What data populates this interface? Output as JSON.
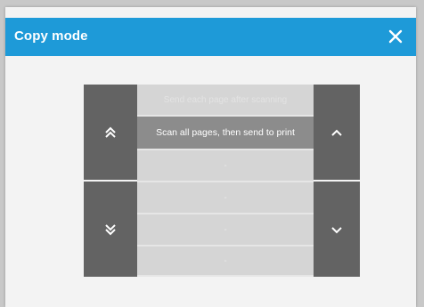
{
  "dialog": {
    "title": "Copy mode",
    "close_icon": "close-icon"
  },
  "navigation": {
    "first_icon": "double-chevron-up-icon",
    "last_icon": "double-chevron-down-icon",
    "up_icon": "chevron-up-icon",
    "down_icon": "chevron-down-icon"
  },
  "modes": [
    {
      "label": "Send each page after scanning",
      "selected": false
    },
    {
      "label": "Scan all pages, then send to print",
      "selected": true
    },
    {
      "label": "-",
      "selected": false
    },
    {
      "label": "-",
      "selected": false
    },
    {
      "label": "-",
      "selected": false
    },
    {
      "label": "-",
      "selected": false
    }
  ],
  "colors": {
    "titlebar": "#1e9ad8",
    "panel_button": "#636363",
    "selected_row": "#8c8c8c"
  }
}
